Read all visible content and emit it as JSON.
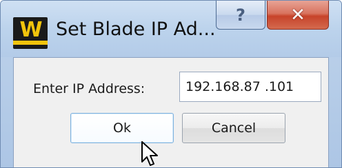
{
  "window": {
    "title": "Set Blade IP Ad...",
    "icon": "w-logo-icon",
    "help_glyph": "?",
    "close_glyph": "✕"
  },
  "form": {
    "ip_label": "Enter IP Address:",
    "ip_value": "192.168.87 .101"
  },
  "buttons": {
    "ok_label": "Ok",
    "cancel_label": "Cancel"
  },
  "colors": {
    "titlebar": "#c6d9ef",
    "close_button": "#c7432a",
    "logo_yellow": "#f2c40c",
    "logo_black": "#1a1a1a"
  }
}
